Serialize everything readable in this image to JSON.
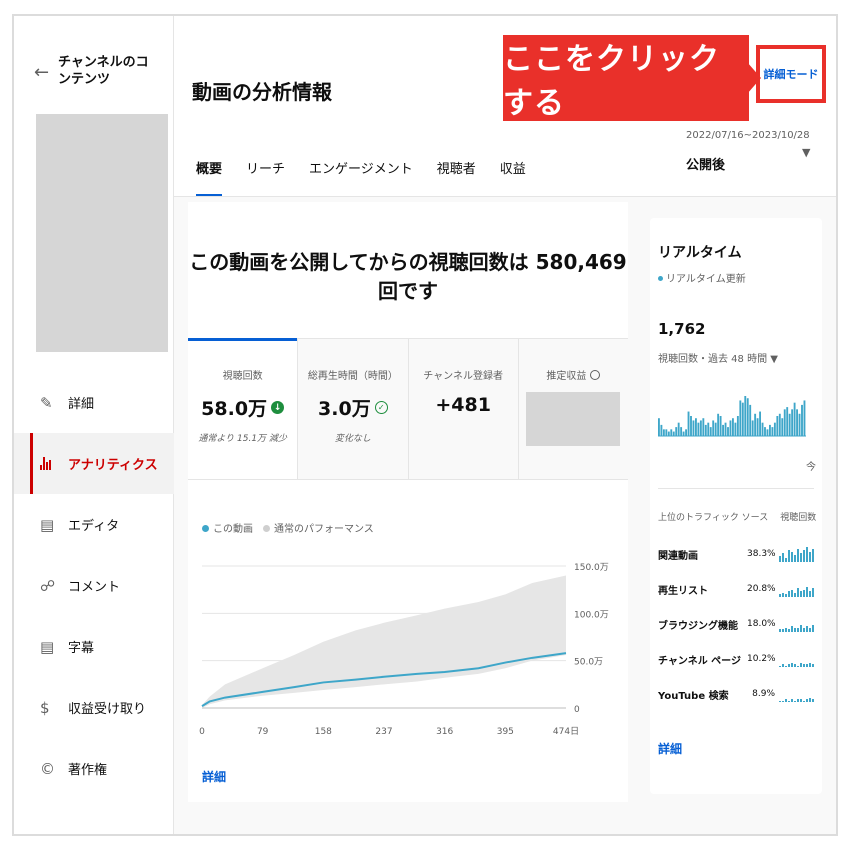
{
  "sidebar": {
    "back_label": "チャンネルのコンテンツ",
    "items": [
      {
        "icon": "pencil-icon",
        "label": "詳細"
      },
      {
        "icon": "analytics-icon",
        "label": "アナリティクス",
        "active": true
      },
      {
        "icon": "editor-icon",
        "label": "エディタ"
      },
      {
        "icon": "comment-icon",
        "label": "コメント"
      },
      {
        "icon": "subtitles-icon",
        "label": "字幕"
      },
      {
        "icon": "dollar-icon",
        "label": "収益受け取り"
      },
      {
        "icon": "copyright-icon",
        "label": "著作権"
      }
    ]
  },
  "header": {
    "title": "動画の分析情報",
    "tabs": [
      "概要",
      "リーチ",
      "エンゲージメント",
      "視聴者",
      "収益"
    ],
    "active_tab": 0,
    "detail_mode": "詳細モード",
    "date_range": "2022/07/16~2023/10/28",
    "period": "公開後"
  },
  "annotation": {
    "text": "ここをクリックする",
    "color": "#e9302a"
  },
  "main": {
    "headline": "この動画を公開してからの視聴回数は 580,469 回です",
    "metrics": [
      {
        "label": "視聴回数",
        "value": "58.0万",
        "sub": "通常より 15.1万 減少"
      },
      {
        "label": "総再生時間（時間）",
        "value": "3.0万",
        "sub": "変化なし"
      },
      {
        "label": "チャンネル登録者",
        "value": "+481",
        "sub": ""
      },
      {
        "label": "推定収益",
        "value": "",
        "sub": ""
      }
    ],
    "legend": [
      "この動画",
      "通常のパフォーマンス"
    ],
    "detail_link": "詳細"
  },
  "chart_data": {
    "type": "line",
    "x_ticks": [
      "0",
      "79",
      "158",
      "237",
      "316",
      "395",
      "474日"
    ],
    "y_ticks": [
      "150.0万",
      "100.0万",
      "50.0万",
      "0"
    ],
    "ylim": [
      0,
      1500000
    ],
    "xlim": [
      0,
      474
    ],
    "series": [
      {
        "name": "この動画",
        "color": "#3ea6c9",
        "x": [
          0,
          10,
          30,
          79,
          120,
          158,
          200,
          237,
          280,
          316,
          360,
          395,
          430,
          474
        ],
        "y": [
          20000,
          70000,
          110000,
          170000,
          220000,
          270000,
          300000,
          330000,
          360000,
          380000,
          420000,
          480000,
          530000,
          580000
        ]
      },
      {
        "name": "通常のパフォーマンス",
        "color": "#e6e6e6",
        "x": [
          0,
          10,
          30,
          79,
          120,
          158,
          200,
          237,
          280,
          316,
          360,
          395,
          430,
          474
        ],
        "y_low": [
          0,
          40000,
          80000,
          130000,
          160000,
          190000,
          220000,
          250000,
          280000,
          320000,
          360000,
          420000,
          500000,
          560000
        ],
        "y_high": [
          30000,
          120000,
          250000,
          420000,
          560000,
          700000,
          820000,
          900000,
          980000,
          1050000,
          1120000,
          1200000,
          1320000,
          1400000
        ]
      }
    ]
  },
  "realtime": {
    "title": "リアルタイム",
    "update": "リアルタイム更新",
    "count": "1,762",
    "count_label": "視聴回数・過去 48 時間 ▼",
    "now_label": "今",
    "bars": [
      8,
      5,
      3,
      3,
      2,
      3,
      2,
      4,
      6,
      4,
      2,
      3,
      11,
      9,
      7,
      8,
      6,
      7,
      8,
      5,
      6,
      4,
      7,
      6,
      10,
      9,
      5,
      6,
      4,
      7,
      8,
      6,
      9,
      16,
      15,
      18,
      17,
      14,
      7,
      10,
      8,
      11,
      6,
      4,
      3,
      5,
      4,
      6,
      9,
      10,
      8,
      12,
      13,
      10,
      12,
      15,
      12,
      10,
      14,
      16
    ],
    "traffic_head": [
      "上位のトラフィック ソース",
      "視聴回数"
    ],
    "traffic": [
      {
        "name": "関連動画",
        "pct": "38.3%",
        "spark": [
          4,
          6,
          3,
          8,
          7,
          5,
          9,
          6,
          8,
          10,
          7,
          9
        ]
      },
      {
        "name": "再生リスト",
        "pct": "20.8%",
        "spark": [
          2,
          3,
          2,
          4,
          5,
          3,
          6,
          4,
          5,
          7,
          4,
          6
        ]
      },
      {
        "name": "ブラウジング機能",
        "pct": "18.0%",
        "spark": [
          2,
          2,
          3,
          2,
          4,
          3,
          3,
          5,
          3,
          4,
          3,
          5
        ]
      },
      {
        "name": "チャンネル ページ",
        "pct": "10.2%",
        "spark": [
          1,
          2,
          1,
          2,
          3,
          2,
          1,
          3,
          2,
          2,
          3,
          2
        ]
      },
      {
        "name": "YouTube 検索",
        "pct": "8.9%",
        "spark": [
          1,
          1,
          2,
          1,
          2,
          1,
          2,
          2,
          1,
          2,
          3,
          2
        ]
      }
    ],
    "detail_link": "詳細"
  }
}
